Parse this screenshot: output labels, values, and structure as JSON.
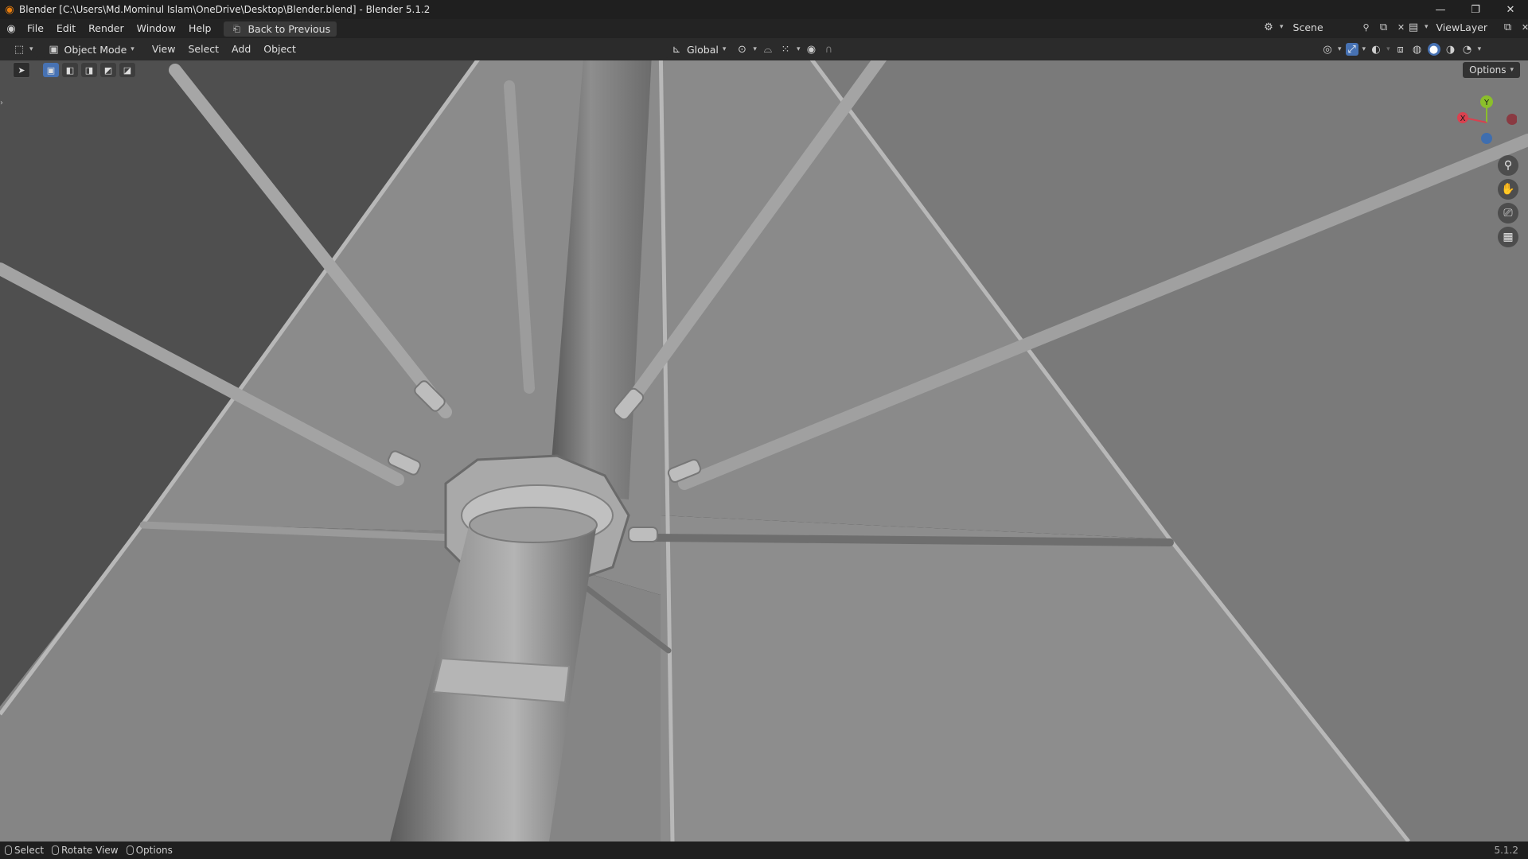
{
  "window": {
    "title": "Blender [C:\\Users\\Md.Mominul Islam\\OneDrive\\Desktop\\Blender.blend] - Blender 5.1.2",
    "minimize": "—",
    "maximize": "❐",
    "close": "✕"
  },
  "menubar": {
    "items": [
      "File",
      "Edit",
      "Render",
      "Window",
      "Help"
    ],
    "back_button": "Back to Previous",
    "scene": "Scene",
    "view_layer": "ViewLayer"
  },
  "header": {
    "mode": "Object Mode",
    "menus": [
      "View",
      "Select",
      "Add",
      "Object"
    ],
    "transform_orientation": "Global"
  },
  "viewport": {
    "options_label": "Options",
    "gizmo": {
      "x": "X",
      "y": "Y"
    }
  },
  "statusbar": {
    "hints": [
      "Select",
      "Rotate View",
      "Options"
    ],
    "version": "5.1.2"
  },
  "icons": {
    "blender": "blender-logo-icon",
    "editor_type": "view3d-icon",
    "zoom": "zoom-icon",
    "pan": "hand-icon",
    "camera": "camera-icon",
    "ortho": "grid-icon"
  }
}
